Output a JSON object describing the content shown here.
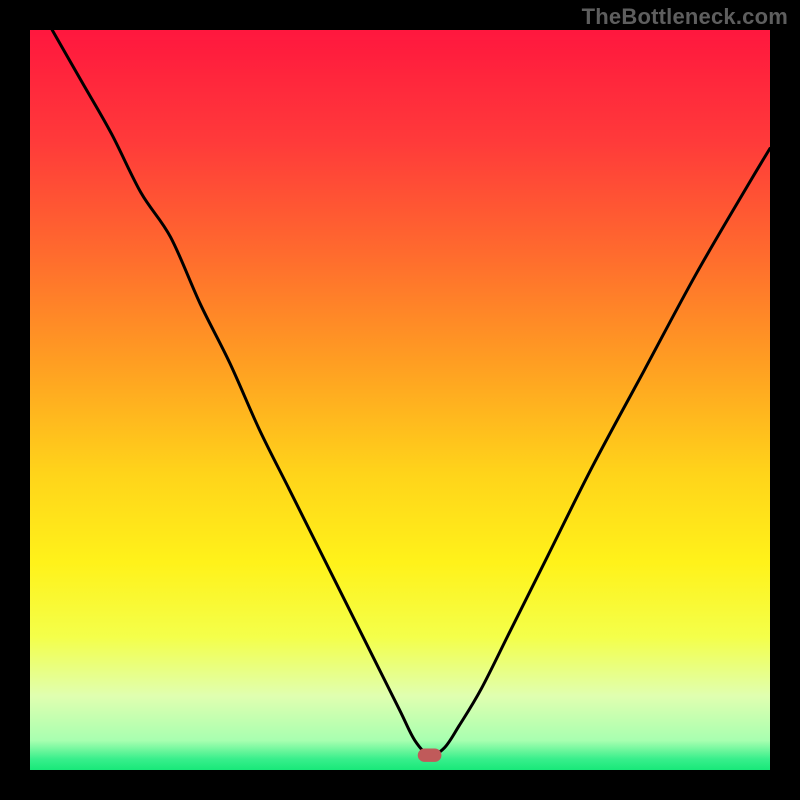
{
  "watermark": "TheBottleneck.com",
  "colors": {
    "frame": "#000000",
    "gradient_stops": [
      {
        "offset": 0.0,
        "color": "#ff173e"
      },
      {
        "offset": 0.15,
        "color": "#ff3a3a"
      },
      {
        "offset": 0.3,
        "color": "#ff6a2e"
      },
      {
        "offset": 0.45,
        "color": "#ff9e22"
      },
      {
        "offset": 0.6,
        "color": "#ffd41a"
      },
      {
        "offset": 0.72,
        "color": "#fff21a"
      },
      {
        "offset": 0.82,
        "color": "#f4ff4a"
      },
      {
        "offset": 0.9,
        "color": "#e0ffb0"
      },
      {
        "offset": 0.96,
        "color": "#a8ffb0"
      },
      {
        "offset": 0.985,
        "color": "#39ef8c"
      },
      {
        "offset": 1.0,
        "color": "#18e879"
      }
    ],
    "curve": "#000000",
    "marker": "#c05a5a"
  },
  "chart_data": {
    "type": "line",
    "title": "",
    "xlabel": "",
    "ylabel": "",
    "xlim": [
      0,
      100
    ],
    "ylim": [
      0,
      100
    ],
    "grid": false,
    "annotations_visible": false,
    "optimal_x": 54,
    "series": [
      {
        "name": "bottleneck-curve",
        "x": [
          3,
          7,
          11,
          15,
          19,
          23,
          27,
          31,
          35,
          39,
          43,
          47,
          50,
          52,
          54,
          56,
          58,
          61,
          65,
          70,
          76,
          83,
          90,
          97,
          100
        ],
        "y": [
          100,
          93,
          86,
          78,
          72,
          63,
          55,
          46,
          38,
          30,
          22,
          14,
          8,
          4,
          2,
          3,
          6,
          11,
          19,
          29,
          41,
          54,
          67,
          79,
          84
        ]
      }
    ],
    "marker": {
      "x": 54,
      "y": 2,
      "rx": 1.6,
      "ry": 0.9
    }
  }
}
